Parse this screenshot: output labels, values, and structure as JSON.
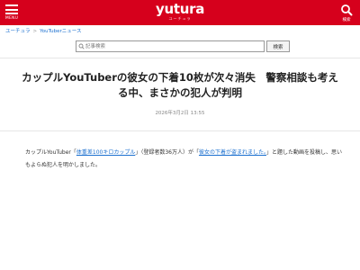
{
  "header": {
    "menu_label": "MENU",
    "logo_text": "yutura",
    "logo_sub": "ユーチュラ",
    "search_label": "検索",
    "brand_color": "#d6001c",
    "icons": {
      "menu": "hamburger-icon",
      "search": "search-icon"
    }
  },
  "breadcrumb": {
    "home": "ユーチュラ",
    "separator": ">",
    "section": "YouTuberニュース"
  },
  "search": {
    "placeholder": "記事検索",
    "value": "",
    "button_label": "検索"
  },
  "article": {
    "title": "カップルYouTuberの彼女の下着10枚が次々消失　警察相談も考える中、まさかの犯人が判明",
    "date": "2026年3月2日 13:55",
    "body": {
      "part1": "カップルYouTuber「",
      "link1": "体重差100キロカップル",
      "part2": "」（登録者数36万人）が「",
      "link2": "彼女の下着が盗まれました。",
      "part3": "」と題した動画を投稿し、思いもよらぬ犯人を明かしました。"
    },
    "link_color": "#1a6fcf"
  }
}
